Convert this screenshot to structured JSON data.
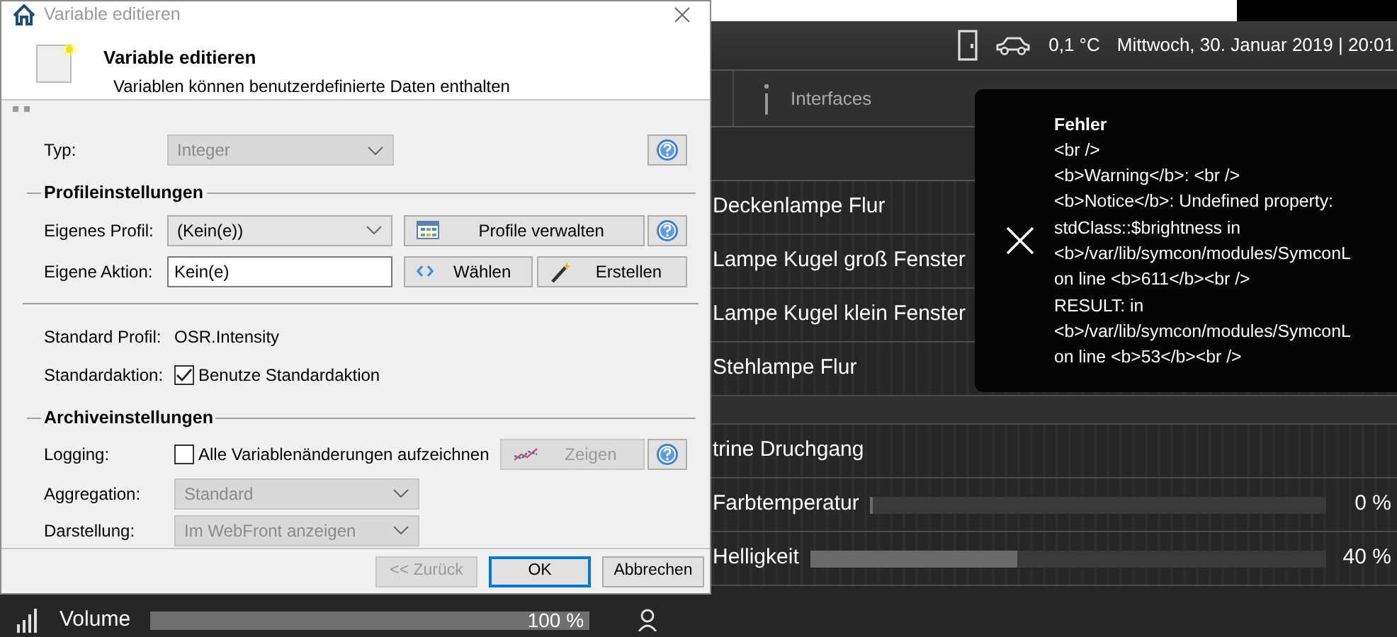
{
  "dialog": {
    "title": "Variable editieren",
    "heading": "Variable editieren",
    "subheading": "Variablen können benutzerdefinierte Daten enthalten",
    "type_row": {
      "label": "Typ:",
      "value": "Integer",
      "disabled": true
    },
    "profile_section": {
      "title": "Profileinstellungen",
      "profile": {
        "label": "Eigenes Profil:",
        "value": "(Kein(e))",
        "disabled": false
      },
      "manage_button": {
        "label": "Profile verwalten",
        "disabled": false
      },
      "action": {
        "label": "Eigene Aktion:",
        "value": "Kein(e)"
      },
      "choose_button": {
        "label": "Wählen",
        "disabled": false
      },
      "create_button": {
        "label": "Erstellen",
        "disabled": false
      },
      "standard_profile": {
        "label": "Standard Profil:",
        "value": "OSR.Intensity"
      },
      "standard_action": {
        "label": "Standardaktion:",
        "text": "Benutze Standardaktion",
        "checked": true
      }
    },
    "archive_section": {
      "title": "Archiveinstellungen",
      "logging": {
        "label": "Logging:",
        "text": "Alle Variablenänderungen aufzeichnen",
        "checked": false
      },
      "show_button": {
        "label": "Zeigen",
        "disabled": true
      },
      "aggregation": {
        "label": "Aggregation:",
        "value": "Standard",
        "disabled": true
      },
      "display": {
        "label": "Darstellung:",
        "value": "Im WebFront anzeigen",
        "disabled": true
      }
    },
    "buttons": [
      {
        "label": "<< Zurück",
        "disabled": true,
        "default": false
      },
      {
        "label": "OK",
        "disabled": false,
        "default": true
      },
      {
        "label": "Abbrechen",
        "disabled": false,
        "default": false
      }
    ]
  },
  "dashboard": {
    "temperature": "0,1 °C",
    "datetime": "Mittwoch, 30. Januar 2019 | 20:01",
    "nav": [
      {
        "label": "Interfaces"
      }
    ],
    "rows": [
      {
        "kind": "label",
        "label": "Deckenlampe Flur"
      },
      {
        "kind": "label",
        "label": "Lampe Kugel groß Fenster"
      },
      {
        "kind": "label",
        "label": "Lampe Kugel klein Fenster"
      },
      {
        "kind": "label",
        "label": "Stehlampe Flur"
      },
      {
        "kind": "gap"
      },
      {
        "kind": "label",
        "label": "trine Druchgang"
      },
      {
        "kind": "slider",
        "label": "Farbtemperatur",
        "level": 0,
        "reading": "0 %"
      },
      {
        "kind": "slider",
        "label": "Helligkeit",
        "level": 0.4,
        "reading": "40 %"
      }
    ],
    "volume": {
      "label": "Volume",
      "level": 1,
      "reading": "100 %"
    },
    "error": {
      "title": "Fehler",
      "lines": [
        "<br />",
        "<b>Warning</b>: <br />",
        "<b>Notice</b>: Undefined property:",
        "stdClass::$brightness in",
        "<b>/var/lib/symcon/modules/SymconL",
        "on line <b>611</b><br />",
        "RESULT: in",
        "<b>/var/lib/symcon/modules/SymconL",
        "on line <b>53</b><br />"
      ]
    }
  }
}
